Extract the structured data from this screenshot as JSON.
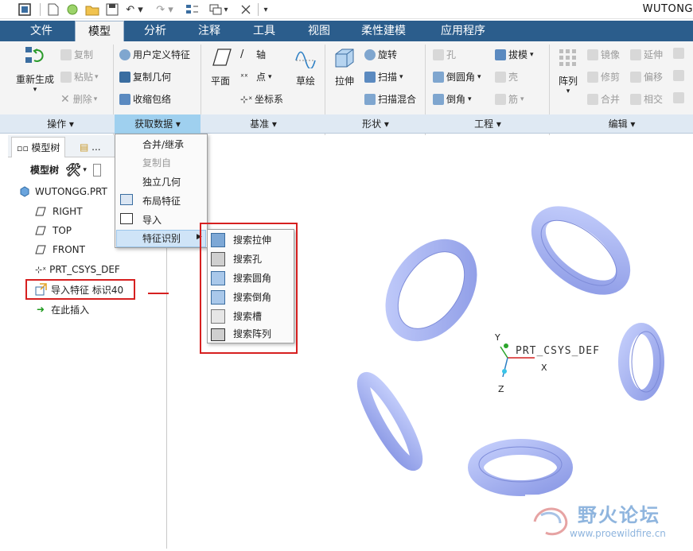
{
  "window": {
    "title": "WUTONG"
  },
  "quick_access": {
    "icons": [
      "app-icon",
      "new-icon",
      "open-circle-icon",
      "open-folder-icon",
      "save-icon",
      "undo-icon",
      "redo-icon",
      "regenerate-icon",
      "windows-icon",
      "close-icon",
      "customize-icon"
    ]
  },
  "tabs": [
    {
      "label": "文件",
      "active": false
    },
    {
      "label": "模型",
      "active": true
    },
    {
      "label": "分析",
      "active": false
    },
    {
      "label": "注释",
      "active": false
    },
    {
      "label": "工具",
      "active": false
    },
    {
      "label": "视图",
      "active": false
    },
    {
      "label": "柔性建模",
      "active": false
    },
    {
      "label": "应用程序",
      "active": false
    }
  ],
  "ribbon": {
    "operations": {
      "regenerate": "重新生成",
      "copy": "复制",
      "paste": "粘贴",
      "delete": "删除"
    },
    "get_data": {
      "udf": "用户定义特征",
      "copy_geometry": "复制几何",
      "shrinkwrap": "收缩包络"
    },
    "datum": {
      "plane": "平面",
      "axis": "轴",
      "point": "点",
      "csys": "坐标系",
      "sketch": "草绘"
    },
    "shapes": {
      "extrude": "拉伸",
      "revolve": "旋转",
      "sweep": "扫描",
      "swept_blend": "扫描混合"
    },
    "engineering": {
      "hole": "孔",
      "draft": "拔模",
      "round": "倒圆角",
      "shell": "壳",
      "chamfer": "倒角",
      "rib": "筋"
    },
    "editing": {
      "pattern": "阵列",
      "mirror": "镜像",
      "extend": "延伸",
      "trim": "修剪",
      "offset": "偏移",
      "merge": "合并",
      "intersect": "相交"
    }
  },
  "groups": [
    {
      "label": "操作 ▾"
    },
    {
      "label": "获取数据 ▾"
    },
    {
      "label": "基准 ▾"
    },
    {
      "label": "形状 ▾"
    },
    {
      "label": "工程 ▾"
    },
    {
      "label": "编辑 ▾"
    }
  ],
  "panel": {
    "tab_model_tree": "模型树",
    "tab_other": "...",
    "toolbar_label": "模型树"
  },
  "tree": {
    "root": "WUTONGG.PRT",
    "items": [
      "RIGHT",
      "TOP",
      "FRONT",
      "PRT_CSYS_DEF",
      "导入特征 标识40",
      "在此插入"
    ]
  },
  "menu_get_data": {
    "items": [
      {
        "label": "合并/继承",
        "enabled": true
      },
      {
        "label": "复制自",
        "enabled": false
      },
      {
        "label": "独立几何",
        "enabled": true
      },
      {
        "label": "布局特征",
        "enabled": true
      },
      {
        "label": "导入",
        "enabled": true
      },
      {
        "label": "特征识别",
        "enabled": true
      }
    ]
  },
  "menu_feature_recognition": {
    "items": [
      "搜索拉伸",
      "搜索孔",
      "搜索圆角",
      "搜索倒角",
      "搜索槽",
      "搜索阵列"
    ]
  },
  "csys": {
    "name": "PRT_CSYS_DEF",
    "x": "X",
    "y": "Y",
    "z": "Z"
  },
  "watermark": {
    "title": "野火论坛",
    "url": "www.proewildfire.cn"
  },
  "colors": {
    "tab_bar": "#2b5d8c",
    "ring_fill": "#a9b6f2",
    "highlight_red": "#d62020",
    "group_active": "#9fd0ef"
  }
}
